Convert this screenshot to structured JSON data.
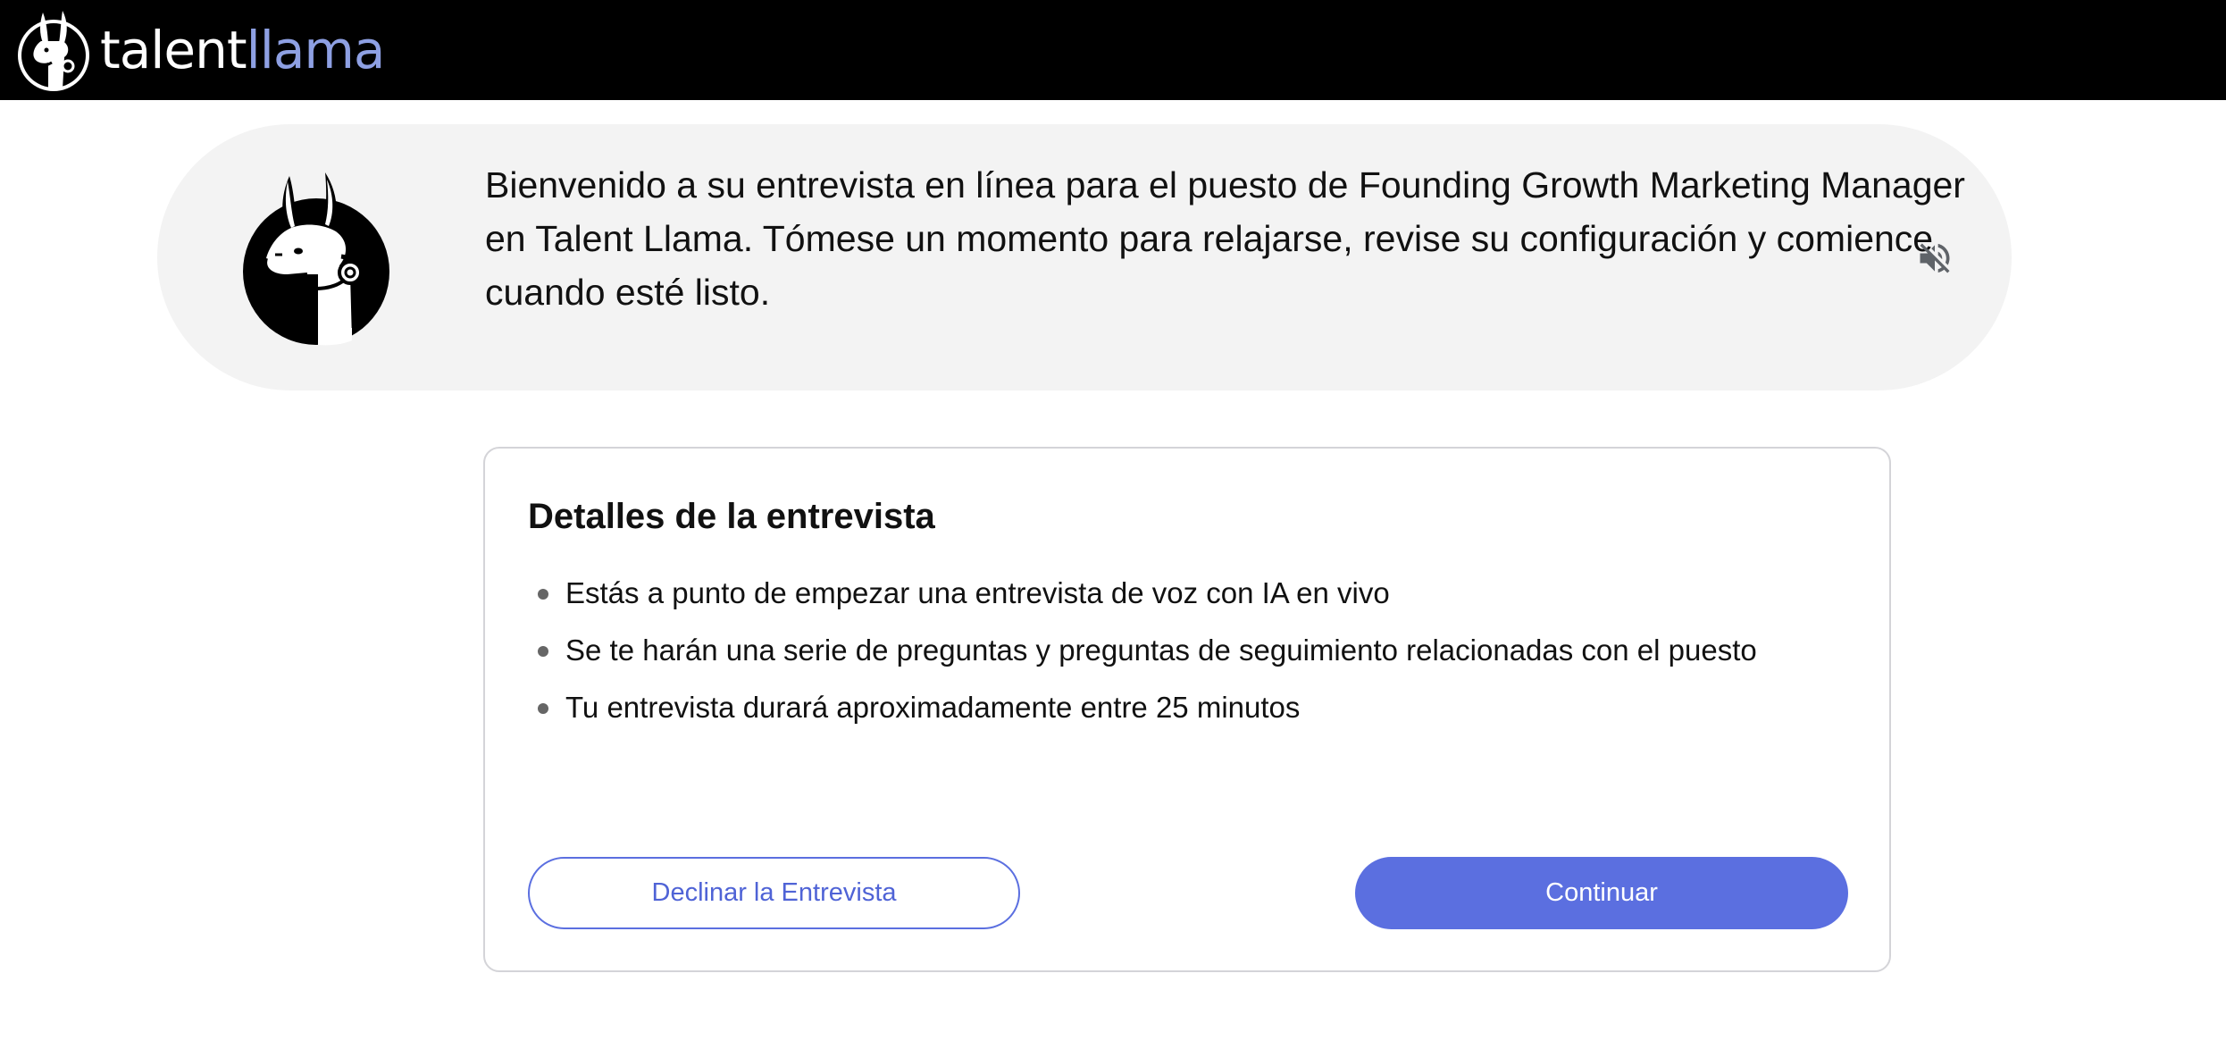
{
  "brand": {
    "name_part1": "talent",
    "name_part2": "llama",
    "logo_icon": "llama-head-icon"
  },
  "banner": {
    "avatar_icon": "llama-headset-avatar",
    "message": "Bienvenido a su entrevista en línea para el puesto de Founding Growth Marketing Manager en Talent Llama. Tómese un momento para relajarse, revise su configuración y comience cuando esté listo.",
    "audio_icon": "volume-off-icon"
  },
  "details": {
    "title": "Detalles de la entrevista",
    "items": [
      "Estás a punto de empezar una entrevista de voz con IA en vivo",
      "Se te harán una serie de preguntas y preguntas de seguimiento relacionadas con el puesto",
      "Tu entrevista durará aproximadamente entre 25 minutos"
    ]
  },
  "actions": {
    "decline_label": "Declinar la Entrevista",
    "continue_label": "Continuar"
  },
  "colors": {
    "topbar": "#000000",
    "brand_accent": "#8ea0e3",
    "primary": "#5b6fe0",
    "banner_bg": "#f3f3f3"
  }
}
